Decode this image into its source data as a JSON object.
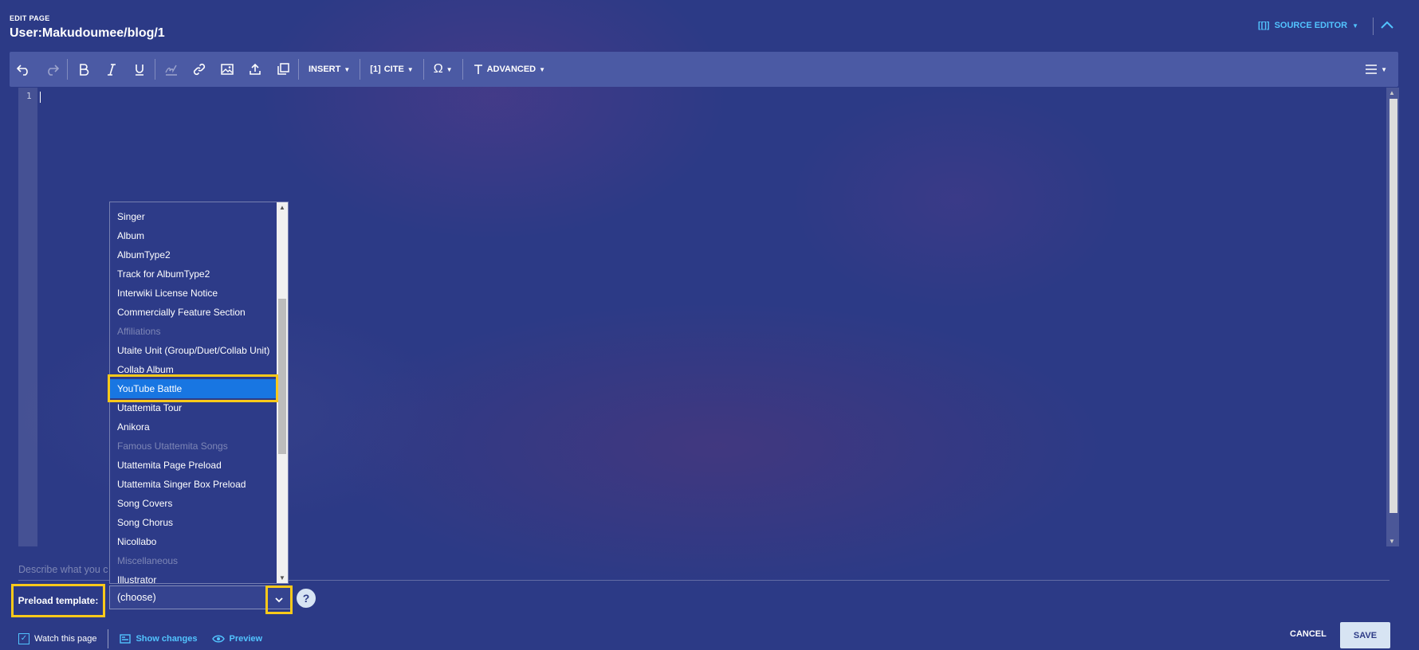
{
  "header": {
    "edit_label": "EDIT PAGE",
    "page_title": "User:Makudoumee/blog/1",
    "source_editor_label": "SOURCE EDITOR",
    "source_editor_glyph": "[[]]"
  },
  "toolbar": {
    "insert_label": "INSERT",
    "cite_label": "CITE",
    "cite_glyph": "[1]",
    "special_glyph": "Ω",
    "advanced_label": "ADVANCED"
  },
  "editor": {
    "line_number": "1"
  },
  "summary": {
    "placeholder": "Describe what you c"
  },
  "preload": {
    "label": "Preload template:",
    "selected": "(choose)",
    "help": "?",
    "options": [
      {
        "label": "Singer",
        "disabled": false
      },
      {
        "label": "Album",
        "disabled": false
      },
      {
        "label": "AlbumType2",
        "disabled": false
      },
      {
        "label": "Track for AlbumType2",
        "disabled": false
      },
      {
        "label": "Interwiki License Notice",
        "disabled": false
      },
      {
        "label": "Commercially Feature Section",
        "disabled": false
      },
      {
        "label": "Affiliations",
        "disabled": true
      },
      {
        "label": "Utaite Unit (Group/Duet/Collab Unit)",
        "disabled": false
      },
      {
        "label": "Collab Album",
        "disabled": false
      },
      {
        "label": "YouTube Battle",
        "disabled": false,
        "selected": true
      },
      {
        "label": "Utattemita Tour",
        "disabled": false
      },
      {
        "label": "Anikora",
        "disabled": false
      },
      {
        "label": "Famous Utattemita Songs",
        "disabled": true
      },
      {
        "label": "Utattemita Page Preload",
        "disabled": false
      },
      {
        "label": "Utattemita Singer Box Preload",
        "disabled": false
      },
      {
        "label": "Song Covers",
        "disabled": false
      },
      {
        "label": "Song Chorus",
        "disabled": false
      },
      {
        "label": "Nicollabo",
        "disabled": false
      },
      {
        "label": "Miscellaneous",
        "disabled": true
      },
      {
        "label": "Illustrator",
        "disabled": false
      }
    ]
  },
  "footer": {
    "watch_label": "Watch this page",
    "show_changes_label": "Show changes",
    "preview_label": "Preview",
    "cancel_label": "CANCEL",
    "save_label": "SAVE"
  },
  "colors": {
    "background": "#2c3a86",
    "toolbar": "#4b5aa4",
    "accent": "#52c4ff",
    "highlight": "#fbc91a",
    "selected": "#1876e2"
  }
}
